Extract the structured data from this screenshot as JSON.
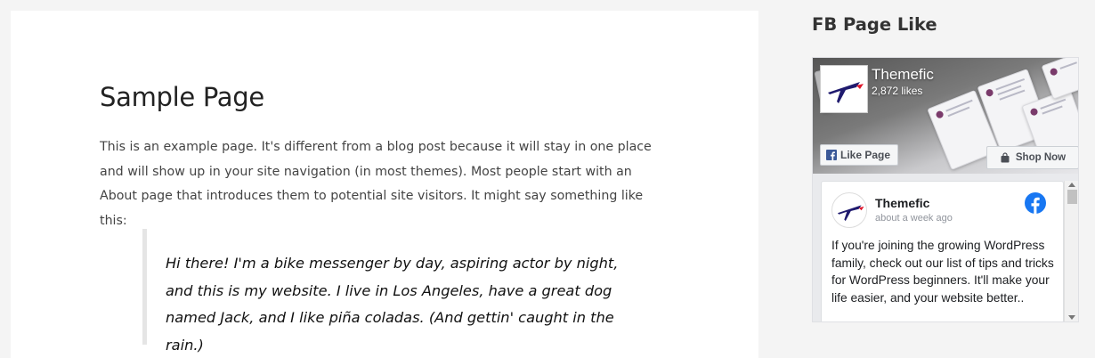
{
  "page": {
    "title": "Sample Page",
    "intro": "This is an example page. It's different from a blog post because it will stay in one place and will show up in your site navigation (in most themes). Most people start with an About page that introduces them to potential site visitors. It might say something like this:",
    "quote": "Hi there! I'm a bike messenger by day, aspiring actor by night, and this is my website. I live in Los Angeles, have a great dog named Jack, and I like piña coladas. (And gettin' caught in the rain.)"
  },
  "sidebar": {
    "widget_title": "FB Page Like",
    "fb_page": {
      "name": "Themefic",
      "likes": "2,872 likes",
      "like_button": "Like Page",
      "shop_button": "Shop Now",
      "post": {
        "author": "Themefic",
        "time": "about a week ago",
        "text": "If you're joining the growing WordPress family, check out our list of tips and tricks for WordPress beginners. It'll make your life easier, and your website better.."
      }
    }
  },
  "colors": {
    "facebook_blue": "#1877f2",
    "logo_navy": "#1f1a6e",
    "logo_red": "#e0182d"
  },
  "icons": [
    "themefic-logo-icon",
    "facebook-f-icon",
    "shopping-bag-icon",
    "facebook-circle-icon"
  ]
}
